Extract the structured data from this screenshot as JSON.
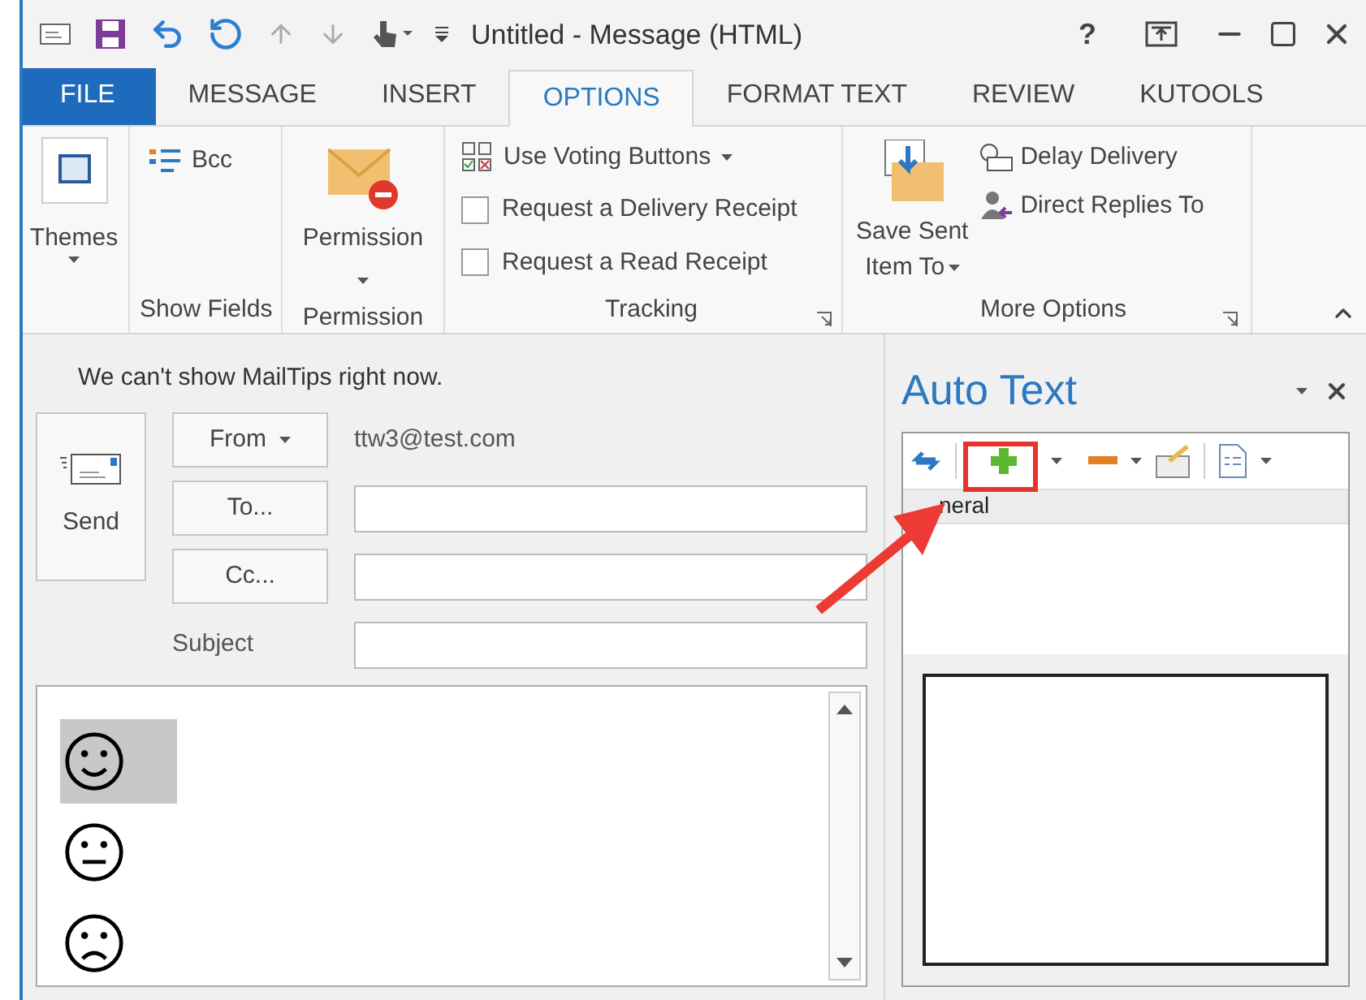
{
  "window": {
    "title": "Untitled - Message (HTML)",
    "help": "?"
  },
  "tabs": [
    {
      "label": "FILE",
      "kind": "file",
      "selected": false
    },
    {
      "label": "MESSAGE",
      "kind": "tab",
      "selected": false
    },
    {
      "label": "INSERT",
      "kind": "tab",
      "selected": false
    },
    {
      "label": "OPTIONS",
      "kind": "tab",
      "selected": true
    },
    {
      "label": "FORMAT TEXT",
      "kind": "tab",
      "selected": false
    },
    {
      "label": "REVIEW",
      "kind": "tab",
      "selected": false
    },
    {
      "label": "KUTOOLS",
      "kind": "tab",
      "selected": false
    }
  ],
  "ribbon": {
    "themes": {
      "label": "Themes"
    },
    "show_fields": {
      "items": [
        "Bcc"
      ],
      "group": "Show Fields"
    },
    "permission": {
      "label": "Permission",
      "group": "Permission"
    },
    "tracking": {
      "voting": "Use Voting Buttons",
      "checkboxes": [
        {
          "label": "Request a Delivery Receipt",
          "checked": false
        },
        {
          "label": "Request a Read Receipt",
          "checked": false
        }
      ],
      "group": "Tracking"
    },
    "more_options": {
      "save_sent": [
        "Save Sent",
        "Item To"
      ],
      "items": [
        "Delay Delivery",
        "Direct Replies To"
      ],
      "group": "More Options"
    }
  },
  "compose": {
    "mailtips": "We can't show MailTips right now.",
    "send": "Send",
    "fields": [
      {
        "label": "From",
        "kind": "dropdown",
        "value": "ttw3@test.com"
      },
      {
        "label": "To...",
        "kind": "button"
      },
      {
        "label": "Cc...",
        "kind": "button"
      },
      {
        "label": "Subject",
        "kind": "label"
      }
    ],
    "body": [
      {
        "kind": "smile",
        "selected": true
      },
      {
        "kind": "neutral",
        "selected": false
      },
      {
        "kind": "frown",
        "selected": false
      }
    ]
  },
  "auto_text": {
    "title": "Auto Text",
    "category": "neral"
  }
}
